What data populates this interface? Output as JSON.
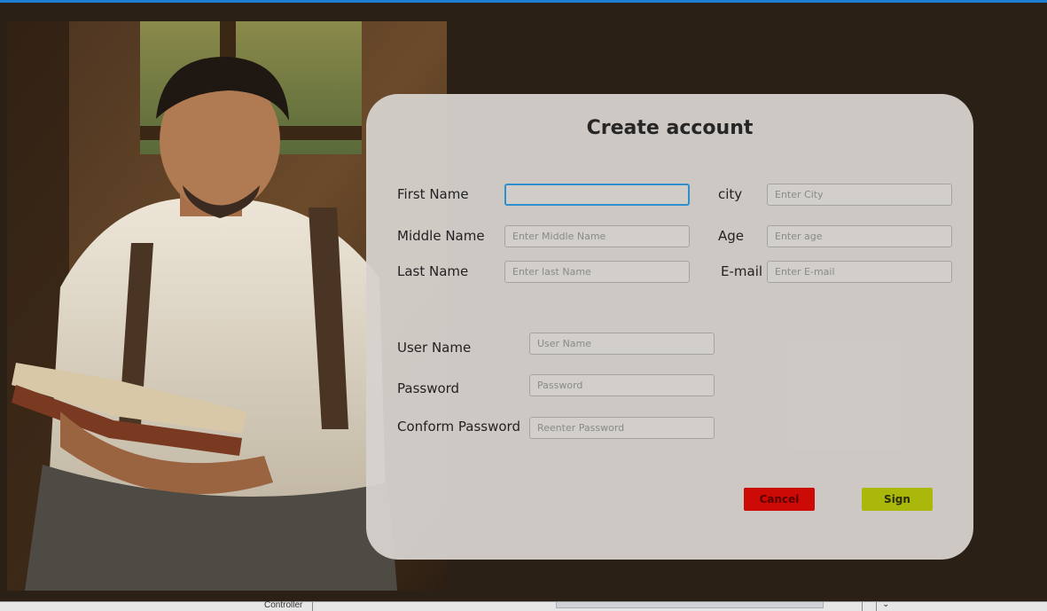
{
  "form": {
    "title": "Create account",
    "fields": {
      "first_name": {
        "label": "First Name",
        "placeholder": ""
      },
      "middle_name": {
        "label": "Middle Name",
        "placeholder": "Enter Middle Name"
      },
      "last_name": {
        "label": "Last Name",
        "placeholder": "Enter last Name"
      },
      "city": {
        "label": "city",
        "placeholder": "Enter City"
      },
      "age": {
        "label": "Age",
        "placeholder": "Enter age"
      },
      "email": {
        "label": "E-mail",
        "placeholder": "Enter E-mail"
      },
      "user_name": {
        "label": "User Name",
        "placeholder": "User Name"
      },
      "password": {
        "label": "Password",
        "placeholder": "Password"
      },
      "confirm_password": {
        "label": "Conform Password",
        "placeholder": "Reenter Password"
      }
    },
    "buttons": {
      "cancel": "Cancel",
      "sign": "Sign"
    }
  },
  "status_bar": {
    "label": "Controller"
  },
  "colors": {
    "background": "#2a2016",
    "cancel": "#cc0a06",
    "sign": "#a9b80a",
    "focus": "#2e8fcf"
  }
}
